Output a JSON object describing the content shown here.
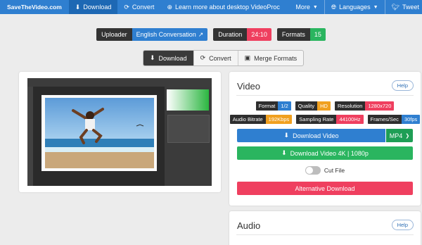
{
  "nav": {
    "brand": "SaveTheVideo.com",
    "items": [
      {
        "label": "Download",
        "icon": "download-circle-icon"
      },
      {
        "label": "Convert",
        "icon": "sync-icon"
      },
      {
        "label": "Learn more about desktop VideoProc",
        "icon": "plus-circle-icon"
      }
    ],
    "more": "More",
    "languages": "Languages",
    "tweet": "Tweet"
  },
  "badges": {
    "uploader_label": "Uploader",
    "uploader_value": "English Conversation",
    "duration_label": "Duration",
    "duration_value": "24:10",
    "formats_label": "Formats",
    "formats_value": "15"
  },
  "tabs": [
    "Download",
    "Convert",
    "Merge Formats"
  ],
  "video": {
    "title": "Video",
    "help": "Help",
    "meta1": [
      {
        "k": "Format",
        "v": "1/2",
        "color": "#2f7fd0"
      },
      {
        "k": "Quality",
        "v": "HD",
        "color": "#f0a020"
      },
      {
        "k": "Resolution",
        "v": "1280x720",
        "color": "#ef3f5f"
      }
    ],
    "meta2": [
      {
        "k": "Audio Bitrate",
        "v": "192Kbps",
        "color": "#f0a020"
      },
      {
        "k": "Sampling Rate",
        "v": "44100Hz",
        "color": "#ef3f5f"
      },
      {
        "k": "Frames/Sec",
        "v": "30fps",
        "color": "#2f7fd0"
      }
    ],
    "download_label": "Download Video",
    "format_select": "MP4",
    "download_4k_label": "Download Video 4K | 1080p",
    "cut_file_label": "Cut File",
    "alt_download_label": "Alternative Download"
  },
  "audio": {
    "title": "Audio",
    "help": "Help"
  },
  "colors": {
    "nav": "#2f7fd0",
    "green": "#1e9e55",
    "red": "#ef3f5f"
  }
}
